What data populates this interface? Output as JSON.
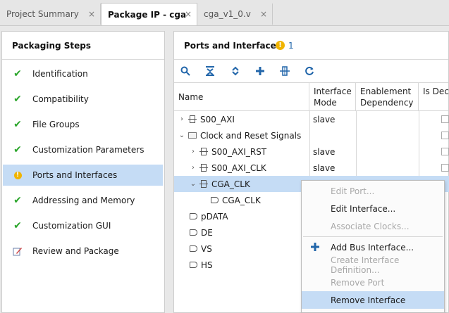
{
  "tabs": [
    {
      "label": "Project Summary",
      "active": false
    },
    {
      "label": "Package IP - cga",
      "active": true
    },
    {
      "label": "cga_v1_0.v",
      "active": false
    }
  ],
  "tab_close_glyph": "×",
  "steps_panel": {
    "title": "Packaging Steps",
    "items": [
      {
        "label": "Identification",
        "status": "done",
        "icon": "check-icon"
      },
      {
        "label": "Compatibility",
        "status": "done",
        "icon": "check-icon"
      },
      {
        "label": "File Groups",
        "status": "done",
        "icon": "check-icon"
      },
      {
        "label": "Customization Parameters",
        "status": "done",
        "icon": "check-icon"
      },
      {
        "label": "Ports and Interfaces",
        "status": "warning",
        "icon": "warning-icon",
        "selected": true
      },
      {
        "label": "Addressing and Memory",
        "status": "done",
        "icon": "check-icon"
      },
      {
        "label": "Customization GUI",
        "status": "done",
        "icon": "check-icon"
      },
      {
        "label": "Review and Package",
        "status": "pending",
        "icon": "edit-icon"
      }
    ]
  },
  "ports_panel": {
    "title": "Ports and Interfaces",
    "warning_count": "1",
    "toolbar": [
      "search-icon",
      "collapse-all-icon",
      "expand-all-icon",
      "add-icon",
      "auto-infer-icon",
      "refresh-icon"
    ],
    "columns": {
      "name": "Name",
      "interface_mode": "Interface Mode",
      "enablement_dependency": "Enablement Dependency",
      "is_declared": "Is Declar"
    },
    "rows": [
      {
        "name": "S00_AXI",
        "mode": "slave",
        "kind": "interface",
        "expander": "›",
        "has_checkbox": true
      },
      {
        "name": "Clock and Reset Signals",
        "mode": "",
        "kind": "group",
        "expander": "⌄",
        "has_checkbox": true
      },
      {
        "name": "S00_AXI_RST",
        "mode": "slave",
        "kind": "interface",
        "expander": "›",
        "has_checkbox": true
      },
      {
        "name": "S00_AXI_CLK",
        "mode": "slave",
        "kind": "interface",
        "expander": "›",
        "has_checkbox": true
      },
      {
        "name": "CGA_CLK",
        "mode": "",
        "kind": "interface",
        "expander": "⌄",
        "selected": true,
        "has_checkbox": true
      },
      {
        "name": "CGA_CLK",
        "mode": "",
        "kind": "port-out",
        "expander": "",
        "has_checkbox": false
      },
      {
        "name": "pDATA",
        "mode": "",
        "kind": "port-in",
        "expander": "",
        "has_checkbox": false
      },
      {
        "name": "DE",
        "mode": "",
        "kind": "port-in",
        "expander": "",
        "has_checkbox": false
      },
      {
        "name": "VS",
        "mode": "",
        "kind": "port-in",
        "expander": "",
        "has_checkbox": false
      },
      {
        "name": "HS",
        "mode": "",
        "kind": "port-in",
        "expander": "",
        "has_checkbox": false
      }
    ]
  },
  "context_menu": {
    "items": [
      {
        "label": "Edit Port...",
        "enabled": false
      },
      {
        "label": "Edit Interface...",
        "enabled": true
      },
      {
        "label": "Associate Clocks...",
        "enabled": false
      },
      {
        "label": "Add Bus Interface...",
        "enabled": true,
        "icon": "plus-icon"
      },
      {
        "label": "Create Interface Definition...",
        "enabled": false
      },
      {
        "label": "Remove Port",
        "enabled": false
      },
      {
        "label": "Remove Interface",
        "enabled": true,
        "highlighted": true
      }
    ]
  },
  "colors": {
    "selection": "#c5dcf5",
    "check": "#2aa52a",
    "warning": "#f0b400",
    "toolbar_icon": "#2266aa"
  }
}
